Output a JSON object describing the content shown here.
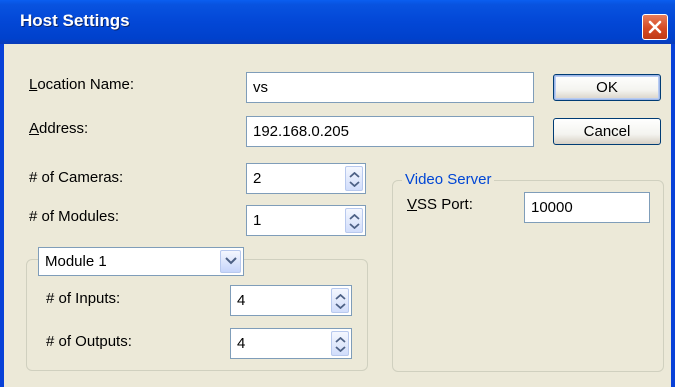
{
  "window": {
    "title": "Host Settings"
  },
  "fields": {
    "location_name": {
      "label": "Location Name:",
      "value": "vs"
    },
    "address": {
      "label": "Address:",
      "value": "192.168.0.205"
    },
    "cameras": {
      "label": "# of Cameras:",
      "value": "2"
    },
    "modules": {
      "label": "# of Modules:",
      "value": "1"
    }
  },
  "buttons": {
    "ok": "OK",
    "cancel": "Cancel"
  },
  "module_group": {
    "selected": "Module 1",
    "inputs": {
      "label": "# of Inputs:",
      "value": "4"
    },
    "outputs": {
      "label": "# of Outputs:",
      "value": "4"
    }
  },
  "video_server": {
    "title": "Video Server",
    "vss_port": {
      "label": "VSS Port:",
      "value": "10000"
    }
  },
  "colors": {
    "titlebar": "#0347d6",
    "group_title": "#0046d5",
    "close": "#d64a24"
  }
}
